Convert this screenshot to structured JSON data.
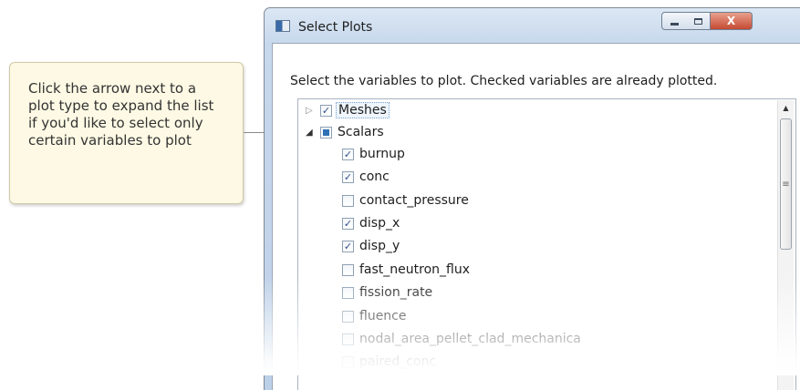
{
  "callout": {
    "text": "Click the arrow next to a plot type to expand the list if you'd like to select only certain variables to plot"
  },
  "window": {
    "title": "Select Plots",
    "controls": {
      "minimize": "minimize",
      "maximize": "maximize",
      "close": "X"
    }
  },
  "dialog": {
    "instructions": "Select the variables to plot. Checked variables are already plotted."
  },
  "tree": {
    "groups": [
      {
        "label": "Meshes",
        "expanded": false,
        "checked": true
      },
      {
        "label": "Scalars",
        "expanded": true,
        "checked": "partial"
      }
    ],
    "scalars": [
      {
        "label": "burnup",
        "checked": true
      },
      {
        "label": "conc",
        "checked": true
      },
      {
        "label": "contact_pressure",
        "checked": false
      },
      {
        "label": "disp_x",
        "checked": true
      },
      {
        "label": "disp_y",
        "checked": true
      },
      {
        "label": "fast_neutron_flux",
        "checked": false
      },
      {
        "label": "fission_rate",
        "checked": false
      },
      {
        "label": "fluence",
        "checked": false
      },
      {
        "label": "nodal_area_pellet_clad_mechanica",
        "checked": false
      },
      {
        "label": "paired_conc",
        "checked": false
      }
    ]
  },
  "icons": {
    "expand": "triangle-right-icon",
    "collapse": "triangle-down-icon",
    "scroll_up": "arrow-up-icon",
    "scroll_grip": "grip-icon"
  },
  "colors": {
    "callout_bg": "#fdf9e4",
    "titlebar": "#c7d8ec",
    "close_button": "#c54a33",
    "check_mark": "#2f4f8f"
  }
}
